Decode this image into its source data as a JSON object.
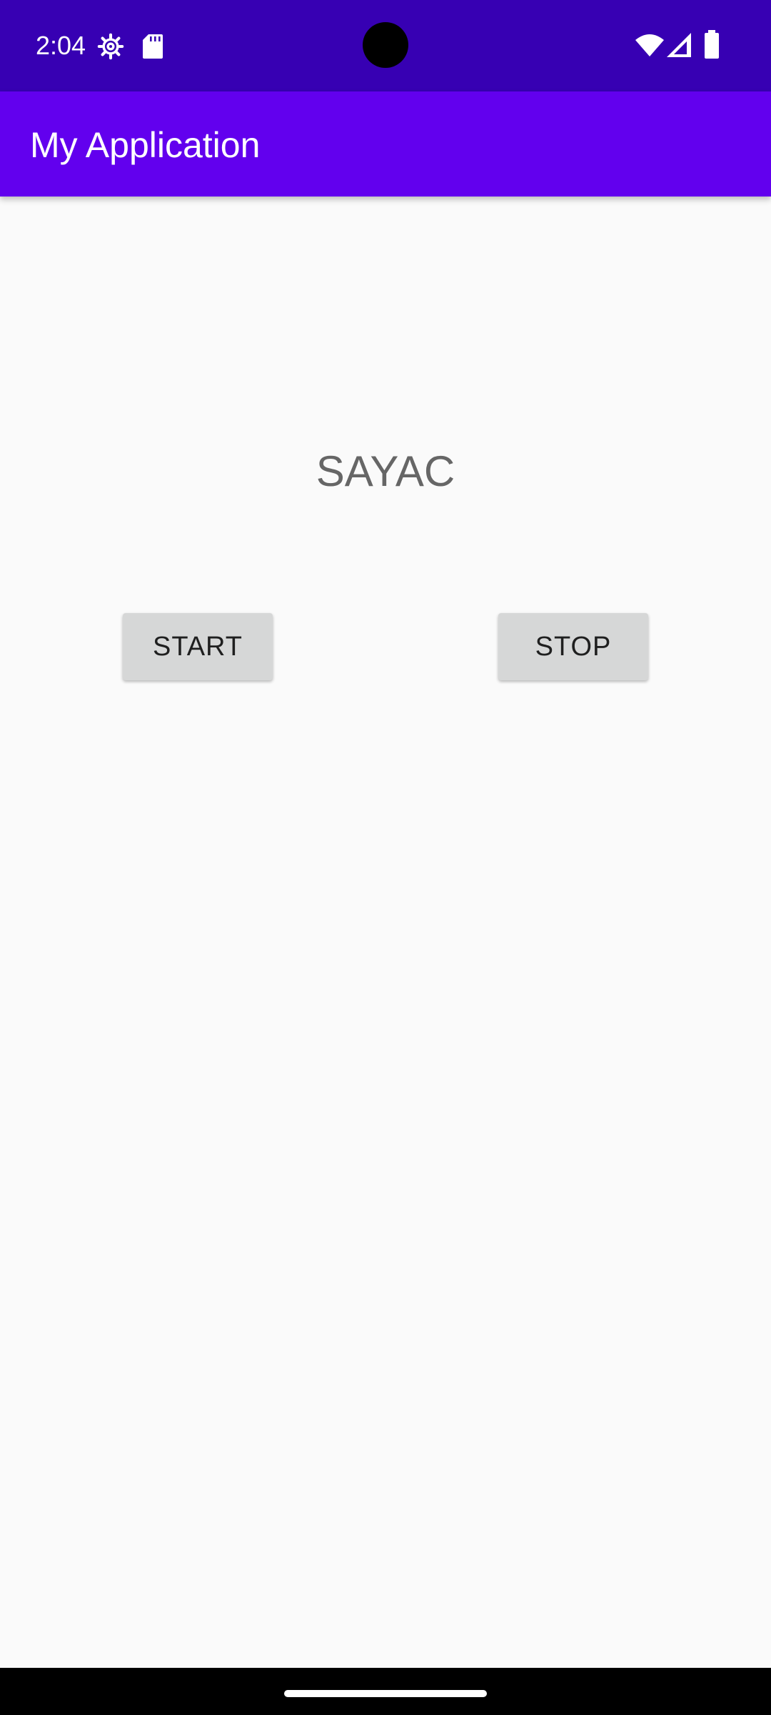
{
  "status_bar": {
    "time": "2:04",
    "icons": [
      "settings-gear-icon",
      "sd-card-icon",
      "wifi-icon",
      "cellular-signal-icon",
      "battery-icon"
    ],
    "background_color": "#3700b3"
  },
  "app_bar": {
    "title": "My Application",
    "background_color": "#6200ee"
  },
  "main": {
    "counter_text": "SAYAC",
    "start_button_label": "START",
    "stop_button_label": "STOP",
    "button_color": "#d6d7d7"
  },
  "nav_bar": {
    "handle": "gesture-home-handle"
  }
}
